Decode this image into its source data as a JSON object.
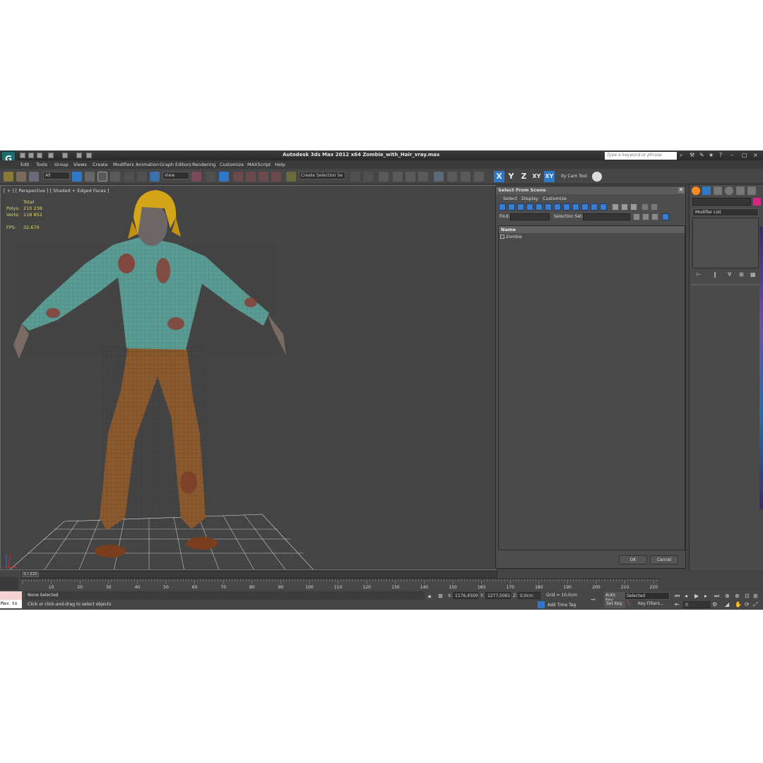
{
  "title_bar": {
    "window_title": "Autodesk 3ds Max  2012 x64     Zombie_with_Hair_vray.max",
    "search_placeholder": "Type a keyword or phrase",
    "logo_glyph": "G"
  },
  "menu": [
    "Edit",
    "Tools",
    "Group",
    "Views",
    "Create",
    "Modifiers",
    "Animation",
    "Graph Editors",
    "Rendering",
    "Customize",
    "MAXScript",
    "Help"
  ],
  "toolbar": {
    "selection_filter": "All",
    "reference_coord": "View",
    "create_selection_set": "Create Selection Se",
    "axis_x": "X",
    "axis_y": "Y",
    "axis_z": "Z",
    "axis_xy": "XY",
    "axis_xy2": "XY",
    "cam_tool": "ity Cam Tool"
  },
  "viewport": {
    "label": "[ + ] [ Perspective ] [ Shaded + Edged Faces ]",
    "stats": {
      "total_label": "Total",
      "polys_label": "Polys:",
      "polys_value": "210 238",
      "verts_label": "Verts:",
      "verts_value": "118 852",
      "fps_label": "FPS:",
      "fps_value": "32,670"
    }
  },
  "dialog": {
    "title": "Select From Scene",
    "menu": [
      "Select",
      "Display",
      "Customize"
    ],
    "find_label": "Find:",
    "selection_set_label": "Selection Set:",
    "column_name": "Name",
    "items": [
      "Zombie"
    ],
    "ok_label": "OK",
    "cancel_label": "Cancel"
  },
  "command_panel": {
    "modifier_list": "Modifier List",
    "object_color": "#d02a86"
  },
  "timeline": {
    "current": "0 / 225",
    "ticks": [
      "10",
      "20",
      "30",
      "40",
      "50",
      "60",
      "70",
      "80",
      "90",
      "100",
      "110",
      "120",
      "130",
      "140",
      "150",
      "160",
      "170",
      "180",
      "190",
      "200",
      "210",
      "220"
    ]
  },
  "status": {
    "maxscript_text": "Max to",
    "main": "None Selected",
    "prompt": "Click or click-and-drag to select objects",
    "x_label": "X:",
    "x_value": "1176,4509",
    "y_label": "Y:",
    "y_value": "1277,5061",
    "z_label": "Z:",
    "z_value": "0,0cm",
    "grid": "Grid = 10,0cm",
    "add_time_tag": "Add Time Tag",
    "auto_key": "Auto Key",
    "set_key": "Set Key",
    "selected_dropdown": "Selected",
    "key_filters": "Key Filters...",
    "frame": "0"
  }
}
